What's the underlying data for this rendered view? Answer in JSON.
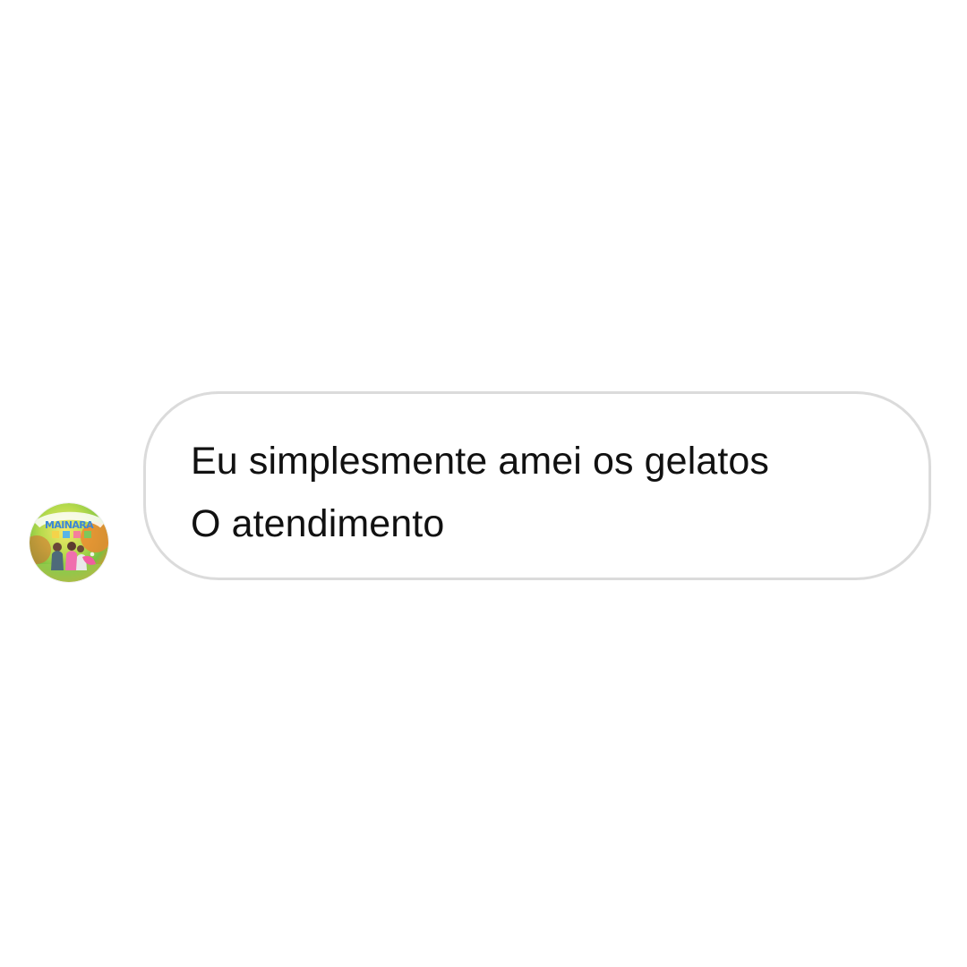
{
  "message": {
    "line1": "Eu simplesmente amei os gelatos",
    "line2": "O atendimento"
  },
  "avatar": {
    "icon": "profile-photo-avatar",
    "logo_text": "MAINARA"
  },
  "colors": {
    "background": "#ffffff",
    "bubble_border": "#dbdbdb",
    "text": "#111111"
  }
}
